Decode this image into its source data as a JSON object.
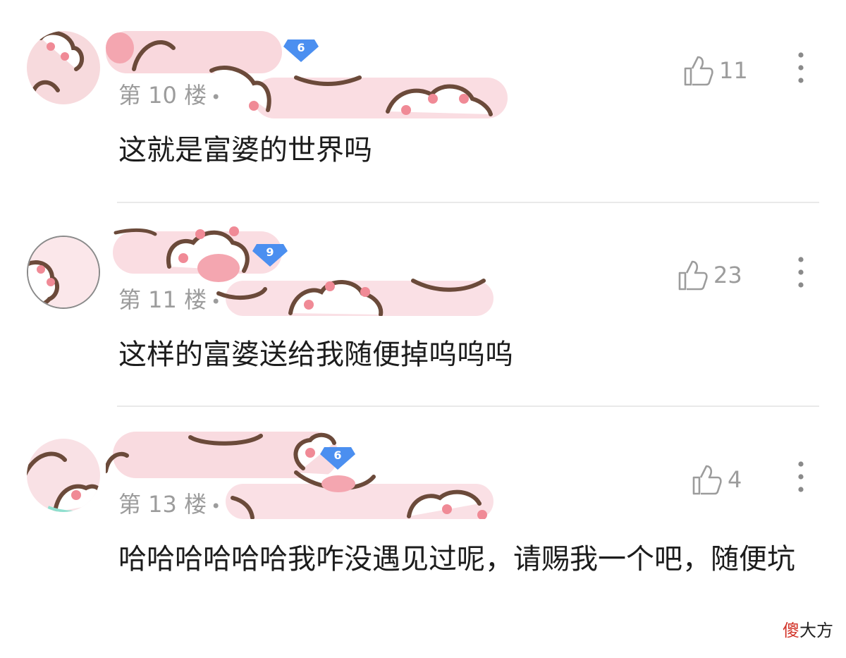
{
  "colors": {
    "mask_pink": "#f6c7cf",
    "paw_brown": "#6b4a3a",
    "badge_blue": "#4b8ff0",
    "meta_gray": "#9c9c9c"
  },
  "icons": {
    "like": "thumbs-up-icon",
    "more": "more-vertical-icon",
    "badge": "level-badge-icon"
  },
  "comments": [
    {
      "level": "6",
      "floor": "第 10 楼",
      "dot": "•",
      "likes": "11",
      "text": "这就是富婆的世界吗"
    },
    {
      "level": "9",
      "floor": "第 11 楼",
      "dot": "•",
      "likes": "23",
      "text": "这样的富婆送给我随便掉呜呜呜"
    },
    {
      "level": "6",
      "floor": "第 13 楼",
      "dot": "•",
      "likes": "4",
      "text": "哈哈哈哈哈哈我咋没遇见过呢，请赐我一个吧，随便坑"
    }
  ],
  "watermark": {
    "part1": "傻",
    "part2": "大方"
  }
}
